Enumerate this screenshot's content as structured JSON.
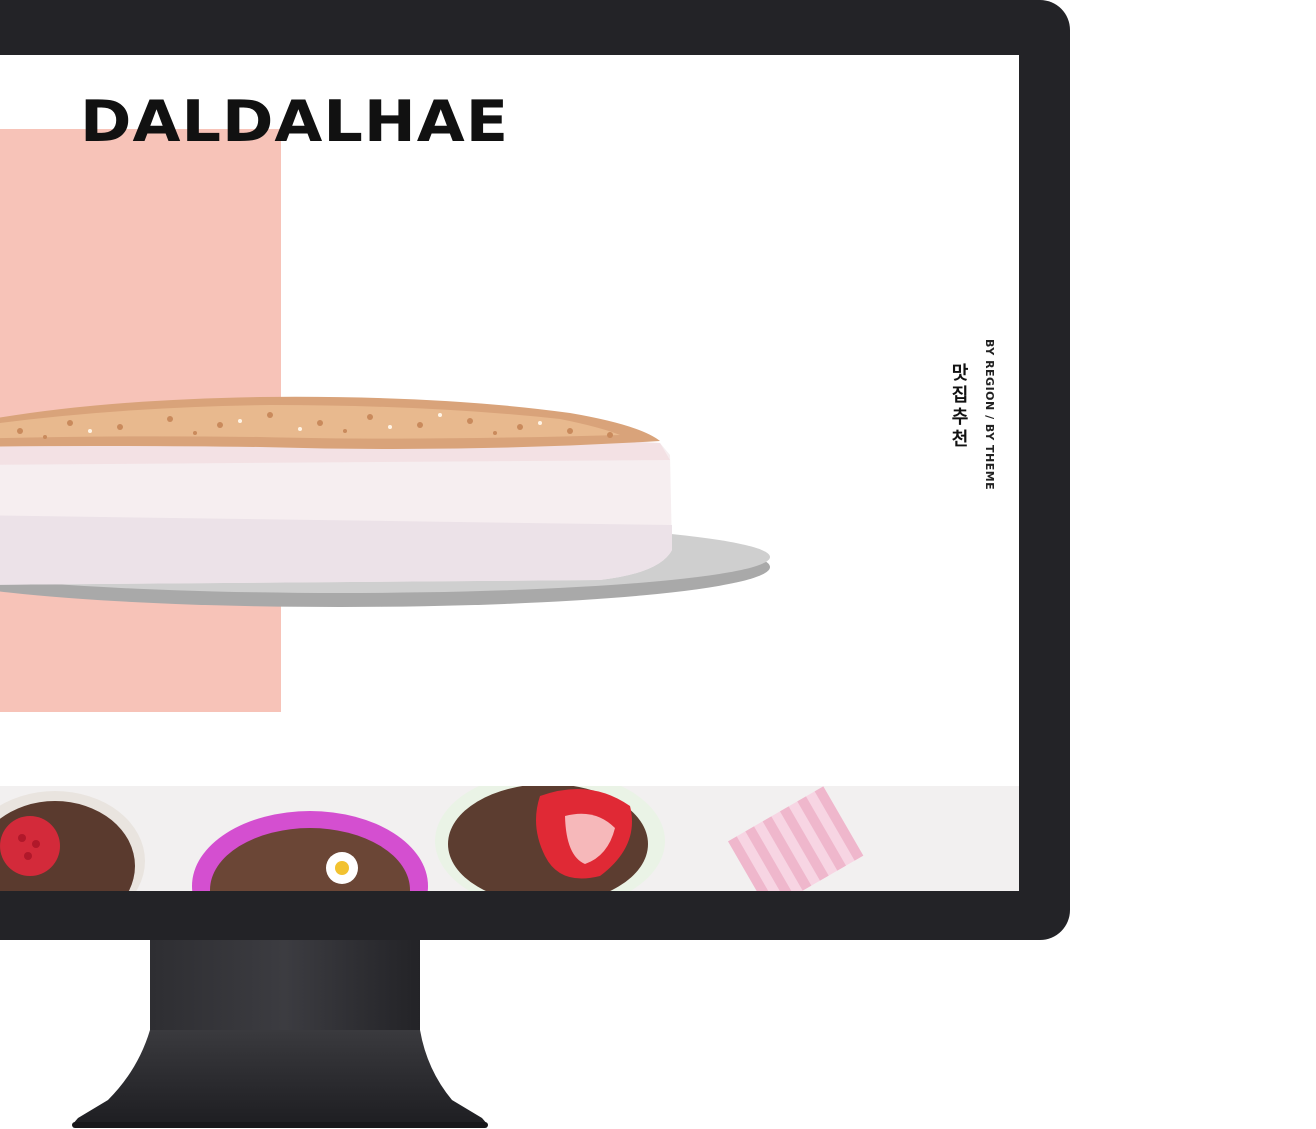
{
  "brand": {
    "logo_text": "DALDALHAE"
  },
  "nav": {
    "title_ko": "맛집추천",
    "subtitle": "BY REGION / BY THEME"
  },
  "colors": {
    "bezel": "#232327",
    "accent_pink": "#f7c3b8",
    "screen_bg": "#ffffff"
  },
  "images": {
    "hero": "cake-on-plate",
    "strip": [
      "raspberry-chocolate-cupcake",
      "daisy-chocolate-cupcake",
      "strawberry-chocolate-cupcake",
      "pink-gingham-napkin"
    ]
  }
}
